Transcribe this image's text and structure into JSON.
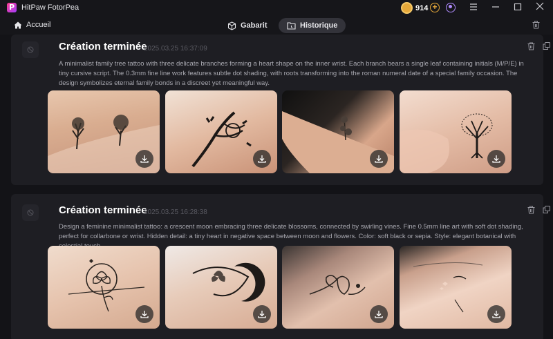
{
  "app": {
    "title": "HitPaw FotorPea",
    "coins": "914"
  },
  "nav": {
    "home_label": "Accueil",
    "tabs": [
      {
        "label": "Gabarit",
        "active": false
      },
      {
        "label": "Historique",
        "active": true
      }
    ]
  },
  "history": [
    {
      "title": "Création terminée",
      "timestamp": "2025.03.25 16:37:09",
      "prompt": "A minimalist family tree tattoo with three delicate branches forming a heart shape on the inner wrist. Each branch bears a single leaf containing initials (M/P/E) in tiny cursive script. The 0.3mm fine line work features subtle dot shading, with roots transforming into the roman numeral date of a special family occasion. The design symbolizes eternal family bonds in a discreet yet meaningful way.",
      "images": [
        "family-tree-tattoo-1",
        "family-tree-tattoo-2",
        "family-tree-tattoo-3",
        "family-tree-tattoo-4"
      ]
    },
    {
      "title": "Création terminée",
      "timestamp": "2025.03.25 16:28:38",
      "prompt": "Design a feminine minimalist tattoo: a crescent moon embracing three delicate blossoms, connected by swirling vines. Fine 0.5mm line art with soft dot shading, perfect for collarbone or wrist. Hidden detail: a tiny heart in negative space between moon and flowers. Color: soft black or sepia. Style: elegant botanical with celestial touch.",
      "images": [
        "moon-flower-tattoo-1",
        "moon-flower-tattoo-2",
        "moon-flower-tattoo-3",
        "moon-flower-tattoo-4"
      ]
    }
  ],
  "colors": {
    "accent_coin": "#e7a93a",
    "accent_user": "#b18cff",
    "brand": "#ff3d8b"
  }
}
